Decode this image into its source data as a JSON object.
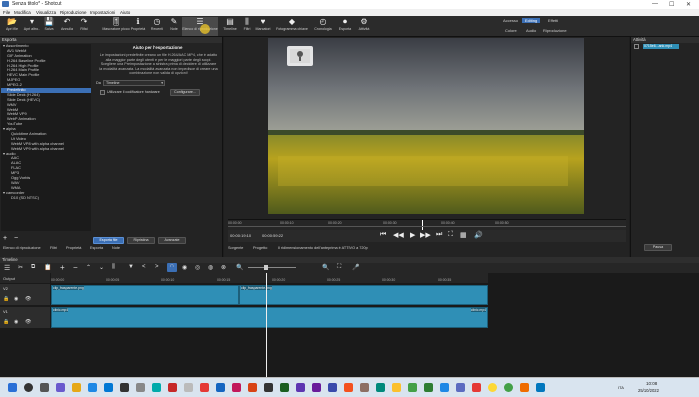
{
  "window": {
    "title": "Senza titolo* - Shotcut",
    "minimize": "—",
    "maximize": "☐",
    "close": "✕"
  },
  "menu": [
    "File",
    "Modifica",
    "Visualizza",
    "Riproduzione",
    "Impostazioni",
    "Aiuto"
  ],
  "toolbar": [
    {
      "label": "Apri file",
      "icon": "📂"
    },
    {
      "label": "Apri altro..",
      "icon": "▾"
    },
    {
      "label": "Salva",
      "icon": "💾"
    },
    {
      "label": "Annulla",
      "icon": "↶"
    },
    {
      "label": "Rifai",
      "icon": "↷"
    },
    {
      "label": "Mascratore picco",
      "icon": "🎚"
    },
    {
      "label": "Proprietà",
      "icon": "ℹ"
    },
    {
      "label": "Recenti",
      "icon": "◷"
    },
    {
      "label": "Note",
      "icon": "✎"
    },
    {
      "label": "Elenco di riproduzione",
      "icon": "☰"
    },
    {
      "label": "Timeline",
      "icon": "▤"
    },
    {
      "label": "Filtri",
      "icon": "⫼"
    },
    {
      "label": "Marcatori",
      "icon": "♥"
    },
    {
      "label": "Fotogramma chiave",
      "icon": "◆"
    },
    {
      "label": "Cronologia",
      "icon": "◴"
    },
    {
      "label": "Esporta",
      "icon": "⏺"
    },
    {
      "label": "Attività",
      "icon": "⚙"
    }
  ],
  "layouts": {
    "top": [
      "Accesso",
      "Editing",
      "Effetti"
    ],
    "bottom": [
      "Colore",
      "Audio",
      "Riproduzione"
    ],
    "active": "Editing"
  },
  "export": {
    "panel_title": "Esporta",
    "presets_header": "Preimpostazioni",
    "search_placeholder": "cerca",
    "presets": [
      {
        "label": "▾ Assortimento",
        "indent": 0
      },
      {
        "label": "AV1 WebM",
        "indent": 2
      },
      {
        "label": "GIF Animation",
        "indent": 2
      },
      {
        "label": "H.264 Baseline Profile",
        "indent": 2
      },
      {
        "label": "H.264 High Profile",
        "indent": 2
      },
      {
        "label": "H.264 Main Profile",
        "indent": 2
      },
      {
        "label": "HEVC Main Profile",
        "indent": 2
      },
      {
        "label": "MJPEG",
        "indent": 2
      },
      {
        "label": "MPEG-2",
        "indent": 2
      },
      {
        "label": "Predefinito",
        "indent": 2,
        "selected": true
      },
      {
        "label": "Slide Deck (H.264)",
        "indent": 2
      },
      {
        "label": "Slide Deck (HEVC)",
        "indent": 2
      },
      {
        "label": "WMV",
        "indent": 2
      },
      {
        "label": "WebM",
        "indent": 2
      },
      {
        "label": "WebM VP9",
        "indent": 2
      },
      {
        "label": "WebP Animation",
        "indent": 2
      },
      {
        "label": "YouTube",
        "indent": 2
      },
      {
        "label": "▾ alpha",
        "indent": 0
      },
      {
        "label": "Quicktime Animation",
        "indent": 4
      },
      {
        "label": "Ut Video",
        "indent": 4
      },
      {
        "label": "WebM VP8 with alpha channel",
        "indent": 4
      },
      {
        "label": "WebM VP9 with alpha channel",
        "indent": 4
      },
      {
        "label": "▾ audio",
        "indent": 0
      },
      {
        "label": "AAC",
        "indent": 4
      },
      {
        "label": "ALAC",
        "indent": 4
      },
      {
        "label": "FLAC",
        "indent": 4
      },
      {
        "label": "MP3",
        "indent": 4
      },
      {
        "label": "Ogg Vorbis",
        "indent": 4
      },
      {
        "label": "WAV",
        "indent": 4
      },
      {
        "label": "WMA",
        "indent": 4
      },
      {
        "label": "▾ camcorder",
        "indent": 0
      },
      {
        "label": "D10 (SD NTSC)",
        "indent": 4
      }
    ],
    "info_title": "Aiuto per l'esportazione",
    "info_text": "Le impostazioni predefinite creano un file H.264/AAC MP4, che è adatto alla maggior parte degli utenti e per le maggiori parte degli scopi. Scegliere una Preimpostazione a sinistra prima di decidere di utilizzare la modalità avanzata. La modalità avanzata non impedisce di creare una combinazione non valida di opzioni!",
    "from_label": "Da",
    "from_value": "Timeline",
    "hw_label": "Utilizzare il codificatore hardware",
    "configure": "Configurare...",
    "bottom_buttons": [
      "Esporta file",
      "Ripristina",
      "Avanzate"
    ],
    "bottom_tabs": [
      "Elenco di riproduzione",
      "Filtri",
      "Proprietà",
      "Esporta",
      "Note"
    ],
    "add": "+",
    "remove": "−"
  },
  "viewer": {
    "ruler_ticks": [
      "00:00:00",
      "00:00:10",
      "00:00:20",
      "00:00:30",
      "00:00:40",
      "00:00:50"
    ],
    "current_time": "00:00:19:10",
    "duration": "00:00:59:22",
    "tabs": [
      "Sorgente",
      "Progetto"
    ],
    "status": "Il ridimensionamento dell'anteprima è ATTIVO a 720p"
  },
  "jobs": {
    "title": "Attività",
    "item": "0715e6...ank.mp4",
    "pause": "Pausa"
  },
  "timeline": {
    "title": "Timeline",
    "output": "Output",
    "tracks": [
      {
        "name": "V2"
      },
      {
        "name": "V1"
      }
    ],
    "ticks": [
      "00:00:00",
      "00:00:05",
      "00:00:10",
      "00:00:15",
      "00:00:20",
      "00:00:25",
      "00:00:30",
      "00:00:35",
      "00:00:40",
      "00:00:45"
    ],
    "clip_label_a": "clip_frasparente.png",
    "clip_label_b": "clip_frasparente.png",
    "clip_label_v1": "clinic.mp4",
    "clip_label_v1b": "clinic.mp4"
  },
  "taskbar": {
    "lang": "ITA",
    "time": "10:08",
    "date": "25/10/2022"
  },
  "colors": {
    "accent": "#3b6fb5",
    "clip": "#2f8fb6",
    "panel": "#232323",
    "bg": "#1e1e1e"
  }
}
